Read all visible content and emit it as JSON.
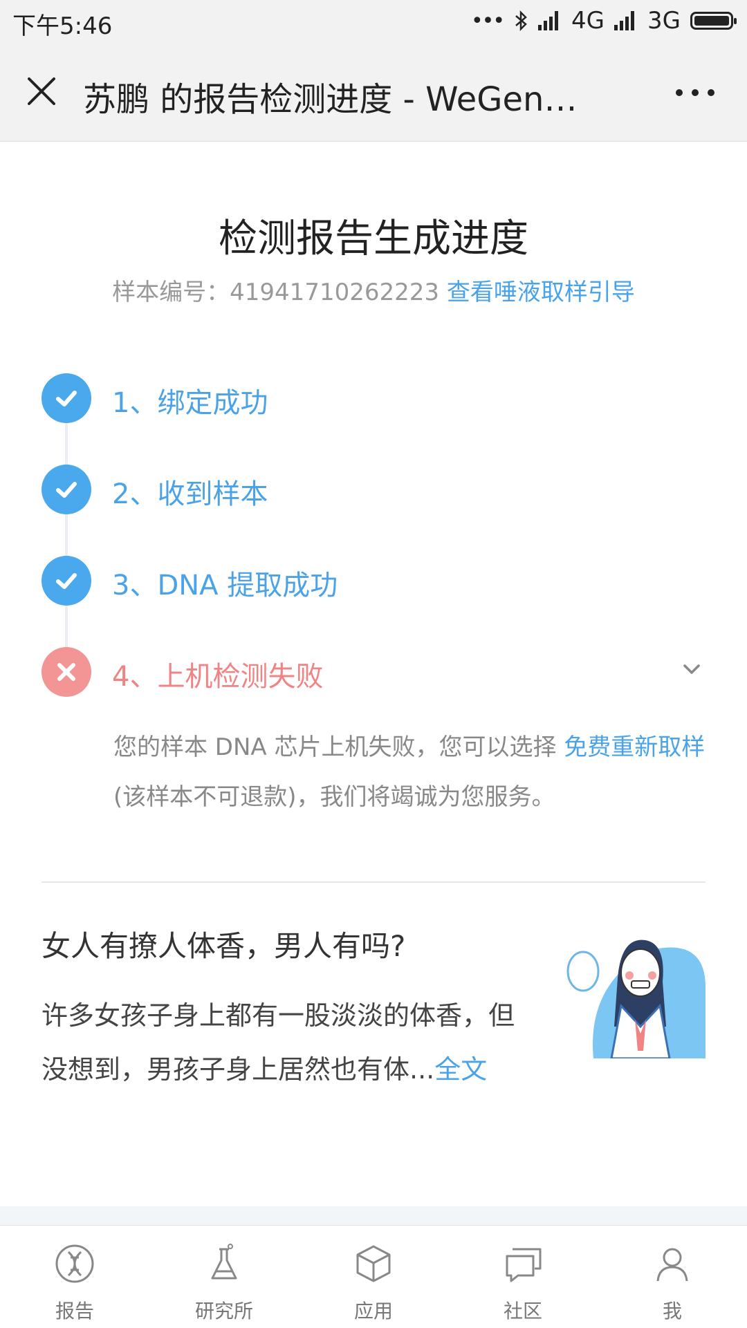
{
  "status": {
    "time": "下午5:46",
    "net1": "4G",
    "net2": "3G"
  },
  "titlebar": {
    "title": "苏鹏 的报告检测进度 - WeGene..."
  },
  "main": {
    "heading": "检测报告生成进度",
    "sample_label": "样本编号：",
    "sample_number": "41941710262223",
    "sample_link": "查看唾液取样引导",
    "steps": [
      {
        "label": "1、绑定成功",
        "state": "done"
      },
      {
        "label": "2、收到样本",
        "state": "done"
      },
      {
        "label": "3、DNA 提取成功",
        "state": "done"
      },
      {
        "label": "4、上机检测失败",
        "state": "failed"
      }
    ],
    "fail_text_1": "您的样本 DNA 芯片上机失败，您可以选择 ",
    "fail_link": "免费重新取样",
    "fail_text_2": " (该样本不可退款)，我们将竭诚为您服务。"
  },
  "article": {
    "title": "女人有撩人体香，男人有吗?",
    "body": "许多女孩子身上都有一股淡淡的体香，但没想到，男孩子身上居然也有体...",
    "more_link": "全文"
  },
  "tabs": [
    {
      "label": "报告",
      "icon": "dna-icon"
    },
    {
      "label": "研究所",
      "icon": "flask-icon"
    },
    {
      "label": "应用",
      "icon": "cube-icon"
    },
    {
      "label": "社区",
      "icon": "chat-icon"
    },
    {
      "label": "我",
      "icon": "user-icon"
    }
  ],
  "colors": {
    "accent": "#4aa3e8",
    "done": "#4aa8ec",
    "failed": "#f39595",
    "failed_text": "#f08484"
  }
}
